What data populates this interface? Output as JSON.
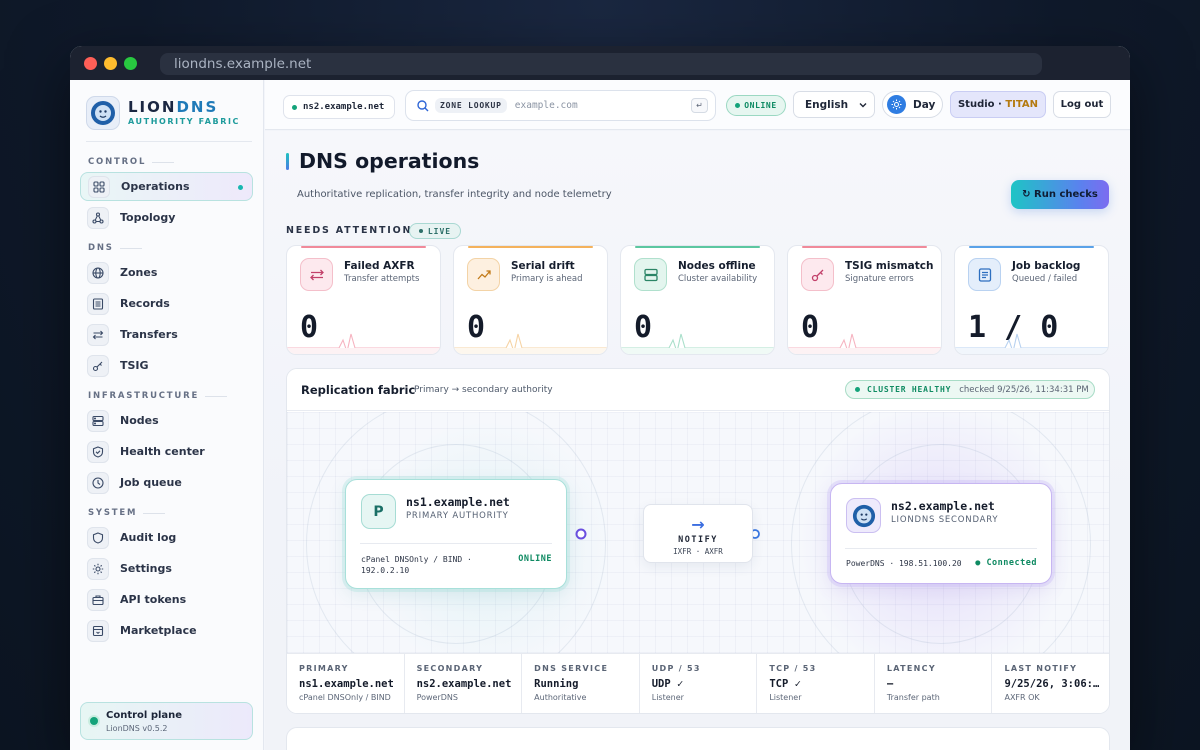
{
  "browser": {
    "url": "liondns.example.net"
  },
  "brand": {
    "name_a": "LION",
    "name_b": "DNS",
    "tagline": "AUTHORITY FABRIC"
  },
  "sidebar": {
    "sections": {
      "control": "CONTROL",
      "dns": "DNS",
      "infrastructure": "INFRASTRUCTURE",
      "system": "SYSTEM"
    },
    "items": {
      "operations": "Operations",
      "topology": "Topology",
      "zones": "Zones",
      "records": "Records",
      "transfers": "Transfers",
      "tsig": "TSIG",
      "nodes": "Nodes",
      "health": "Health center",
      "jobs": "Job queue",
      "audit": "Audit log",
      "settings": "Settings",
      "api": "API tokens",
      "marketplace": "Marketplace"
    },
    "control_plane": {
      "title": "Control plane",
      "version": "LionDNS v0.5.2"
    }
  },
  "topbar": {
    "host": "ns2.example.net",
    "search_chip": "ZONE LOOKUP",
    "search_placeholder": "example.com",
    "enter_key": "↵",
    "status": "ONLINE",
    "language": "English",
    "theme": "Day",
    "studio_a": "Studio",
    "studio_sep": " · ",
    "studio_b": "TITAN",
    "logout": "Log out"
  },
  "page": {
    "title": "DNS operations",
    "subtitle": "Authoritative replication, transfer integrity and node telemetry",
    "run_checks": "↻ Run checks",
    "attention_label": "NEEDS ATTENTION",
    "live": "LIVE"
  },
  "cards": [
    {
      "title": "Failed AXFR",
      "sub": "Transfer attempts",
      "value": "0",
      "accent": "#f08a9a",
      "icon_bg": "#fde9ee"
    },
    {
      "title": "Serial drift",
      "sub": "Primary is ahead",
      "value": "0",
      "accent": "#f4b25c",
      "icon_bg": "#fdf0e0"
    },
    {
      "title": "Nodes offline",
      "sub": "Cluster availability",
      "value": "0",
      "accent": "#5cc7a0",
      "icon_bg": "#e3f5ee"
    },
    {
      "title": "TSIG mismatch",
      "sub": "Signature errors",
      "value": "0",
      "accent": "#f08a9a",
      "icon_bg": "#fde9ee"
    },
    {
      "title": "Job backlog",
      "sub": "Queued / failed",
      "value": "1 / 0",
      "accent": "#5aa2e8",
      "icon_bg": "#e4eefb"
    }
  ],
  "replication": {
    "title": "Replication fabric",
    "subtitle": "Primary → secondary authority",
    "health": "CLUSTER HEALTHY",
    "checked": "checked 9/25/26, 11:34:31 PM",
    "primary": {
      "badge": "P",
      "name": "ns1.example.net",
      "role": "PRIMARY AUTHORITY",
      "meta": "cPanel DNSOnly / BIND · 192.0.2.10",
      "status": "ONLINE"
    },
    "notify": {
      "arrow": "→",
      "label": "NOTIFY",
      "sub": "IXFR · AXFR"
    },
    "secondary": {
      "name": "ns2.example.net",
      "role": "LIONDNS SECONDARY",
      "meta": "PowerDNS · 198.51.100.20",
      "status": "● Connected"
    }
  },
  "stats": [
    {
      "h": "PRIMARY",
      "v": "ns1.example.net",
      "s": "cPanel DNSOnly / BIND"
    },
    {
      "h": "SECONDARY",
      "v": "ns2.example.net",
      "s": "PowerDNS"
    },
    {
      "h": "DNS SERVICE",
      "v": "Running",
      "s": "Authoritative"
    },
    {
      "h": "UDP / 53",
      "v": "UDP ✓",
      "s": "Listener"
    },
    {
      "h": "TCP / 53",
      "v": "TCP ✓",
      "s": "Listener"
    },
    {
      "h": "LATENCY",
      "v": "—",
      "s": "Transfer path"
    },
    {
      "h": "LAST NOTIFY",
      "v": "9/25/26, 3:06:…",
      "s": "AXFR OK"
    }
  ]
}
